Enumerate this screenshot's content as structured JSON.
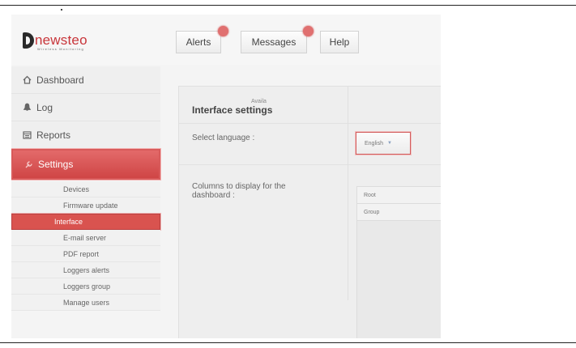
{
  "logo": {
    "brand": "newsteo",
    "tagline": "Wireless Monitoring"
  },
  "top_nav": {
    "buttons": [
      {
        "label": "Alerts",
        "badge": true
      },
      {
        "label": "Messages",
        "badge": true
      },
      {
        "label": "Help",
        "badge": false
      }
    ]
  },
  "sidebar": {
    "items": [
      {
        "label": "Dashboard",
        "icon": "home-icon"
      },
      {
        "label": "Log",
        "icon": "bell-icon"
      },
      {
        "label": "Reports",
        "icon": "reports-icon"
      },
      {
        "label": "Settings",
        "icon": "wrench-icon",
        "active": true
      }
    ],
    "sub_items": [
      {
        "label": "Devices"
      },
      {
        "label": "Firmware update"
      },
      {
        "label": "Interface",
        "active": true
      },
      {
        "label": "E-mail server"
      },
      {
        "label": "PDF report"
      },
      {
        "label": "Loggers alerts"
      },
      {
        "label": "Loggers group"
      },
      {
        "label": "Manage users"
      }
    ]
  },
  "main": {
    "title": "Interface settings",
    "language_label": "Select language :",
    "language_value": "English",
    "columns_label": "Columns to display for the dashboard :",
    "available_header": "Availa",
    "available_columns": [
      "Root",
      "Group"
    ]
  },
  "colors": {
    "accent": "#d9534f",
    "brand": "#c8353a",
    "sidebar_bg": "#efefef"
  }
}
